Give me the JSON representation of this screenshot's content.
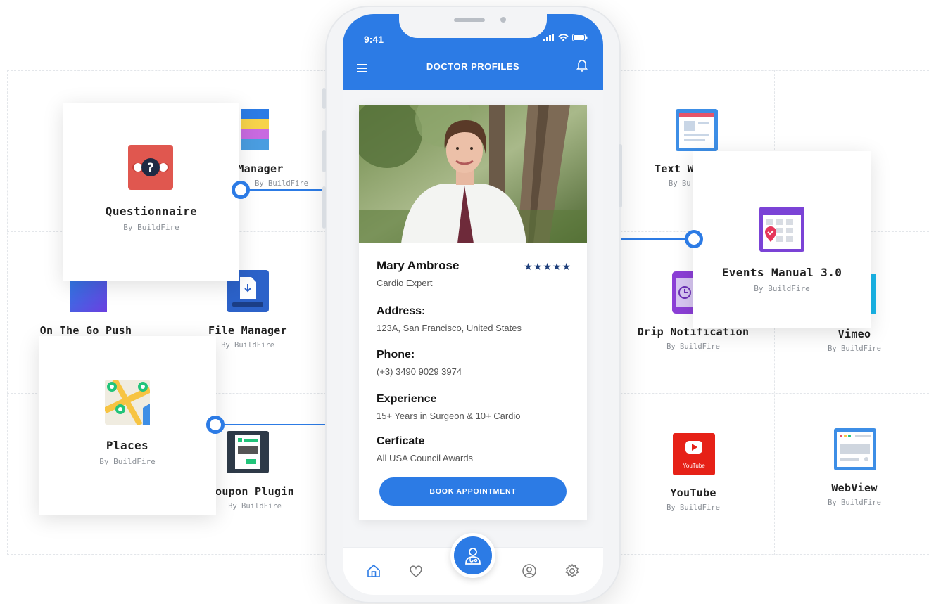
{
  "accent_color": "#2c7be5",
  "background_tiles": [
    {
      "name": "Manager",
      "by": "By BuildFire",
      "icon": "folder-stack-icon"
    },
    {
      "name": "On The Go Push",
      "by": "",
      "icon": "push-notification-icon"
    },
    {
      "name": "File Manager",
      "by": "By BuildFire",
      "icon": "download-file-icon"
    },
    {
      "name": "oupon Plugin",
      "by": "By BuildFire",
      "icon": "coupon-icon"
    },
    {
      "name": "Text W",
      "by": "By Bu",
      "icon": "text-document-icon"
    },
    {
      "name": "Drip Notification",
      "by": "By BuildFire",
      "icon": "phone-clock-icon"
    },
    {
      "name": "Vimeo",
      "by": "By BuildFire",
      "icon": "vimeo-icon"
    },
    {
      "name": "YouTube",
      "by": "By BuildFire",
      "icon": "youtube-icon",
      "icon_caption": "YouTube"
    },
    {
      "name": "WebView",
      "by": "By BuildFire",
      "icon": "browser-window-icon"
    }
  ],
  "cards": {
    "questionnaire": {
      "name": "Questionnaire",
      "by": "By BuildFire",
      "icon": "question-mark-icon"
    },
    "places": {
      "name": "Places",
      "by": "By BuildFire",
      "icon": "map-pins-icon"
    },
    "events": {
      "name": "Events Manual 3.0",
      "by": "By BuildFire",
      "icon": "calendar-icon"
    }
  },
  "phone": {
    "status_time": "9:41",
    "title": "DOCTOR PROFILES",
    "profile": {
      "name": "Mary Ambrose",
      "subtitle": "Cardio Expert",
      "rating": "★★★★★",
      "rating_value": 5,
      "address_label": "Address:",
      "address": "123A, San Francisco, United States",
      "phone_label": "Phone:",
      "phone": "(+3) 3490 9029 3974",
      "experience_label": "Experience",
      "experience": "15+ Years in Surgeon & 10+ Cardio",
      "certificate_label": "Cerficate",
      "certificate": "All USA Council Awards",
      "book_label": "BOOK APPOINTMENT"
    },
    "tabs": [
      "home-icon",
      "heart-icon",
      "doctor-icon",
      "user-icon",
      "settings-icon"
    ]
  }
}
